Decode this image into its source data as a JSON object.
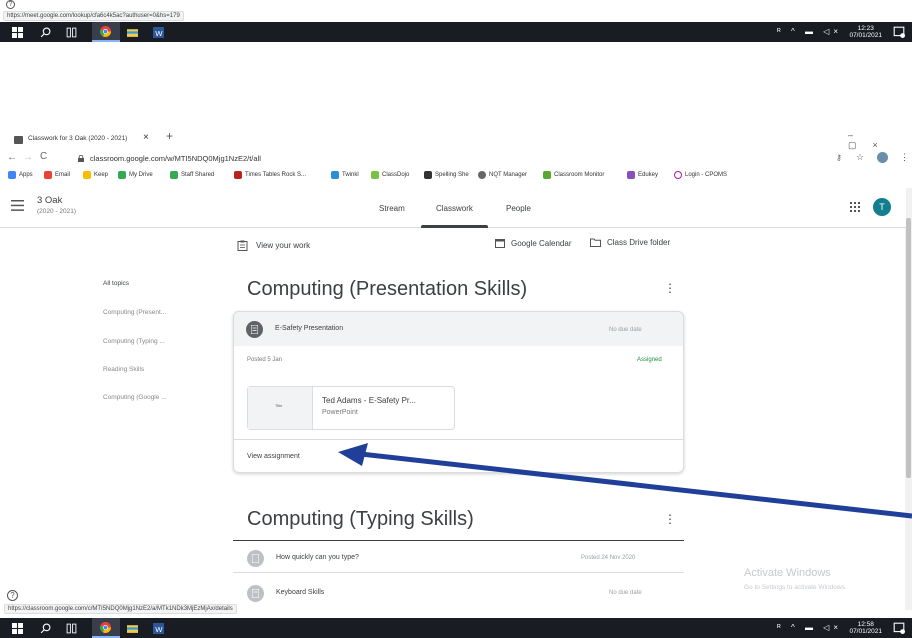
{
  "top_status_url": "https://meet.google.com/lookup/cfa6c4k5ac?authuser=0&hs=179",
  "top_clock": {
    "time": "12:23",
    "date": "07/01/2021"
  },
  "browser": {
    "tab_title": "Classwork for 3 Oak (2020 - 2021)",
    "tab_close": "×",
    "new_tab": "+",
    "address": "classroom.google.com/w/MTI5NDQ0Mjg1NzE2/t/all",
    "bookmarks": [
      "Apps",
      "Email",
      "Keep",
      "My Drive",
      "Staff Shared",
      "Times Tables Rock S...",
      "Twinkl",
      "ClassDojo",
      "Spelling She",
      "NQT Manager",
      "Classroom Monitor",
      "Edukey",
      "Login - CPOMS"
    ]
  },
  "header": {
    "class_name": "3 Oak",
    "class_year": "(2020 - 2021)",
    "tabs": [
      "Stream",
      "Classwork",
      "People"
    ],
    "avatar_letter": "T"
  },
  "actions": {
    "view_your_work": "View your work",
    "google_calendar": "Google Calendar",
    "class_drive_folder": "Class Drive folder"
  },
  "topics": [
    "All topics",
    "Computing (Present...",
    "Computing (Typing ...",
    "Reading Skills",
    "Computing (Google ..."
  ],
  "section1": {
    "title": "Computing (Presentation Skills)",
    "assignment": {
      "title": "E-Safety Presentation",
      "due": "No due date",
      "posted": "Posted 5 Jan",
      "status": "Assigned",
      "attachment_title": "Ted Adams - E-Safety Pr...",
      "attachment_type": "PowerPoint",
      "thumb_label": "Title",
      "view_label": "View assignment"
    }
  },
  "section2": {
    "title": "Computing (Typing Skills)",
    "items": [
      {
        "title": "How quickly can you type?",
        "meta": "Posted 24 Nov 2020"
      },
      {
        "title": "Keyboard Skills",
        "meta": "No due date"
      }
    ]
  },
  "watermark": {
    "line1": "Activate Windows",
    "line2": "Go to Settings to activate Windows."
  },
  "bottom_status_url": "https://classroom.google.com/c/MTI5NDQ0Mjg1NzE2/a/MTk1NDk3MjEzMjAx/details",
  "bottom_clock": {
    "time": "12:58",
    "date": "07/01/2021"
  },
  "colors": {
    "taskbar": "#1a1c24",
    "assigned_green": "#1e8e3e",
    "arrow_blue": "#1f3f99",
    "avatar_teal": "#137e8e"
  }
}
